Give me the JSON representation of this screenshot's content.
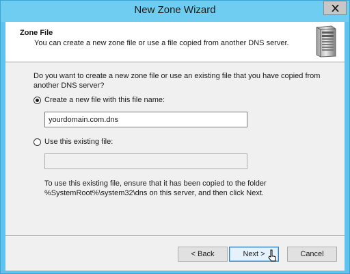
{
  "window": {
    "title": "New Zone Wizard",
    "close_glyph": "✕"
  },
  "header": {
    "title": "Zone File",
    "subtitle": "You can create a new zone file or use a file copied from another DNS server.",
    "icon": "server-icon"
  },
  "body": {
    "question": "Do you want to create a new zone file or use an existing file that you have copied from another DNS server?",
    "option_new": {
      "label": "Create a new file with this file name:",
      "selected": true,
      "value": "yourdomain.com.dns"
    },
    "option_existing": {
      "label": "Use this existing file:",
      "selected": false,
      "value": ""
    },
    "note_line1": "To use this existing file, ensure that it has been copied to the folder",
    "note_line2": "%SystemRoot%\\system32\\dns on this server, and then click Next."
  },
  "buttons": {
    "back": "< Back",
    "next": "Next >",
    "cancel": "Cancel"
  },
  "colors": {
    "titlebar": "#6fcdf2",
    "dialog_bg": "#f0f0f0",
    "default_button_border": "#3c7fb1"
  }
}
